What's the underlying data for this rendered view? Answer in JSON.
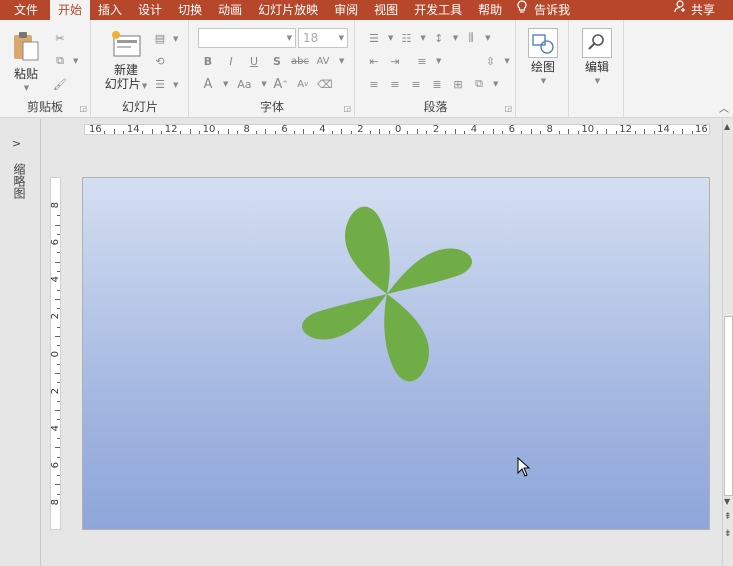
{
  "tabs": [
    {
      "label": "文件",
      "active": false
    },
    {
      "label": "开始",
      "active": true
    },
    {
      "label": "插入",
      "active": false
    },
    {
      "label": "设计",
      "active": false
    },
    {
      "label": "切换",
      "active": false
    },
    {
      "label": "动画",
      "active": false
    },
    {
      "label": "幻灯片放映",
      "active": false
    },
    {
      "label": "审阅",
      "active": false
    },
    {
      "label": "视图",
      "active": false
    },
    {
      "label": "开发工具",
      "active": false
    },
    {
      "label": "帮助",
      "active": false
    }
  ],
  "tell_me": "告诉我",
  "share": "共享",
  "groups": {
    "clipboard": {
      "label": "剪贴板",
      "paste": "粘贴"
    },
    "slides": {
      "label": "幻灯片",
      "new_slide_line1": "新建",
      "new_slide_line2": "幻灯片"
    },
    "font": {
      "label": "字体",
      "font_name": "",
      "font_size": "18"
    },
    "paragraph": {
      "label": "段落"
    },
    "drawing": {
      "label": "绘图"
    },
    "editing": {
      "label": "编辑"
    }
  },
  "left_pane": {
    "label": "缩略图"
  },
  "rulers": {
    "horizontal": [
      "16",
      "14",
      "12",
      "10",
      "8",
      "6",
      "4",
      "2",
      "0",
      "2",
      "4",
      "6",
      "8",
      "10",
      "12",
      "14",
      "16"
    ],
    "vertical": [
      "8",
      "6",
      "4",
      "2",
      "0",
      "2",
      "4",
      "6",
      "8"
    ]
  },
  "colors": {
    "accent": "#b7472a",
    "pinwheel": "#70ad47",
    "slide_top": "#d4dff1",
    "slide_bottom": "#8ea6da"
  }
}
